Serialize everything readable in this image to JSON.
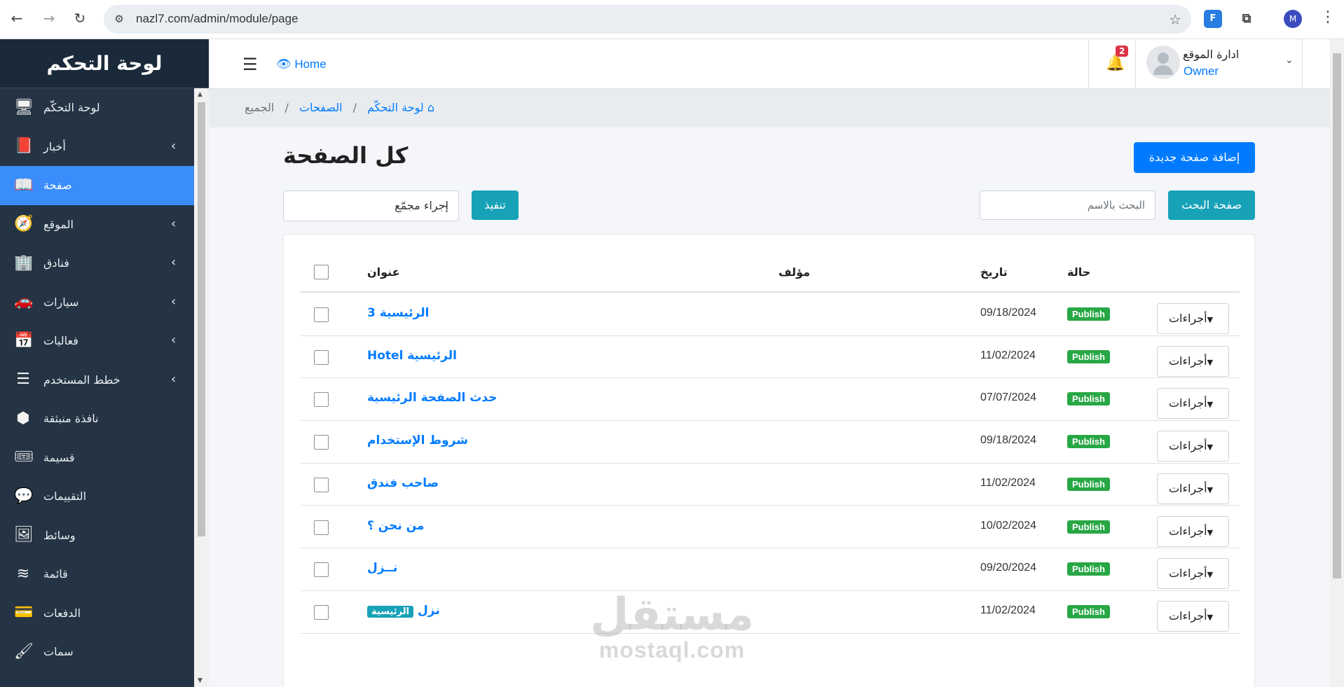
{
  "browser": {
    "url": "nazl7.com/admin/module/page",
    "profile_initial": "M",
    "ext_label": "F"
  },
  "sidebar": {
    "brand": "لوحة التحكم",
    "items": [
      {
        "label": "لوحة التحكّم",
        "icon": "monitor-icon",
        "glyph": "🖥",
        "has_children": false,
        "active": false
      },
      {
        "label": "أخبار",
        "icon": "book-icon",
        "glyph": "📕",
        "has_children": true,
        "active": false
      },
      {
        "label": "صفحة",
        "icon": "open-book-icon",
        "glyph": "📖",
        "has_children": false,
        "active": true
      },
      {
        "label": "الموقع",
        "icon": "compass-icon",
        "glyph": "🧭",
        "has_children": true,
        "active": false
      },
      {
        "label": "فنادق",
        "icon": "building-icon",
        "glyph": "🏢",
        "has_children": true,
        "active": false
      },
      {
        "label": "سيارات",
        "icon": "car-icon",
        "glyph": "🚗",
        "has_children": true,
        "active": false
      },
      {
        "label": "فعاليات",
        "icon": "calendar-icon",
        "glyph": "📅",
        "has_children": true,
        "active": false
      },
      {
        "label": "خطط المستخدم",
        "icon": "list-icon",
        "glyph": "☰",
        "has_children": true,
        "active": false
      },
      {
        "label": "نافذة منبثقة",
        "icon": "cube-icon",
        "glyph": "⬢",
        "has_children": false,
        "active": false
      },
      {
        "label": "قسيمة",
        "icon": "ticket-icon",
        "glyph": "🎟",
        "has_children": false,
        "active": false
      },
      {
        "label": "التقييمات",
        "icon": "comment-icon",
        "glyph": "💬",
        "has_children": false,
        "active": false
      },
      {
        "label": "وسائط",
        "icon": "image-icon",
        "glyph": "🖼",
        "has_children": false,
        "active": false
      },
      {
        "label": "قائمة",
        "icon": "layers-icon",
        "glyph": "≋",
        "has_children": false,
        "active": false
      },
      {
        "label": "الدفعات",
        "icon": "credit-card-icon",
        "glyph": "💳",
        "has_children": false,
        "active": false
      },
      {
        "label": "سمات",
        "icon": "brush-icon",
        "glyph": "🖌",
        "has_children": false,
        "active": false
      }
    ]
  },
  "topbar": {
    "home_label": "Home",
    "notifications_count": "2",
    "user_name": "ادارة الموقع",
    "user_role": "Owner"
  },
  "breadcrumb": {
    "home": "لوحة التحكّم",
    "section": "الصفحات",
    "current": "الجميع"
  },
  "page": {
    "title": "كل الصفحة",
    "add_button": "إضافة صفحة جديدة",
    "search_button": "صفحة البحث",
    "search_placeholder": "البحث بالاسم",
    "bulk_action_selected": "إجراء مجمّع",
    "run_button": "تنفيذ"
  },
  "table": {
    "headers": {
      "title": "عنوان",
      "author": "مؤلف",
      "date": "تاريخ",
      "status": "حالة"
    },
    "actions_label": "أجراءات",
    "main_tag": "الرئيسية",
    "rows": [
      {
        "title": "الرئيسية 3",
        "date": "09/18/2024",
        "status": "Publish",
        "tag": false
      },
      {
        "title": "الرئيسية Hotel",
        "date": "11/02/2024",
        "status": "Publish",
        "tag": false
      },
      {
        "title": "حدث الصفحة الرئيسية",
        "date": "07/07/2024",
        "status": "Publish",
        "tag": false
      },
      {
        "title": "شروط الإستخدام",
        "date": "09/18/2024",
        "status": "Publish",
        "tag": false
      },
      {
        "title": "صاحب فندق",
        "date": "11/02/2024",
        "status": "Publish",
        "tag": false
      },
      {
        "title": "من نحن ؟",
        "date": "10/02/2024",
        "status": "Publish",
        "tag": false
      },
      {
        "title": "نــزل",
        "date": "09/20/2024",
        "status": "Publish",
        "tag": false
      },
      {
        "title": "نزل",
        "date": "11/02/2024",
        "status": "Publish",
        "tag": true
      }
    ]
  },
  "watermark": {
    "arabic": "مستقل",
    "latin": "mostaql.com"
  },
  "colors": {
    "sidebar_bg": "#243444",
    "active_item": "#3c8dfc",
    "primary": "#007bff",
    "info": "#17a2b8",
    "success": "#28a745",
    "danger": "#dc3545"
  }
}
